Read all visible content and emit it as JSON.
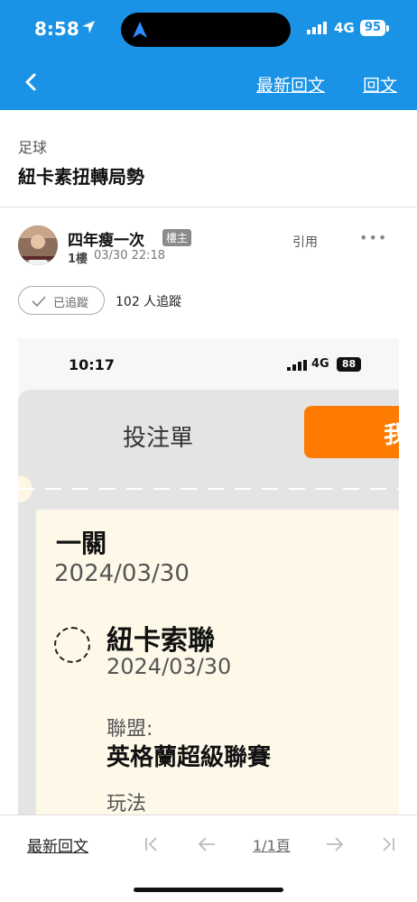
{
  "status_bar": {
    "time": "8:58",
    "network": "4G",
    "battery": "95"
  },
  "nav": {
    "latest_reply": "最新回文",
    "reply": "回文"
  },
  "thread": {
    "category": "足球",
    "title": "紐卡素扭轉局勢"
  },
  "post": {
    "author": "四年瘦一次",
    "op_badge": "樓主",
    "floor": "1樓",
    "date": "03/30 22:18",
    "quote": "引用",
    "more": "•••",
    "follow_label": "已追蹤",
    "follow_count": "102 人追蹤"
  },
  "embedded_image": {
    "time": "10:17",
    "network": "4G",
    "battery": "88",
    "tab_label": "投注單",
    "orange_tab_label": "我",
    "leg_label": "一關",
    "leg_date": "2024/03/30",
    "team": "紐卡索聯",
    "team_date": "2024/03/30",
    "league_label": "聯盟:",
    "league": "英格蘭超級聯賽",
    "play_label": "玩法"
  },
  "bottom_bar": {
    "latest_reply": "最新回文",
    "page_indicator": "1/1頁"
  },
  "colors": {
    "header_blue": "#1a93e6",
    "accent_orange": "#ff7a00"
  }
}
